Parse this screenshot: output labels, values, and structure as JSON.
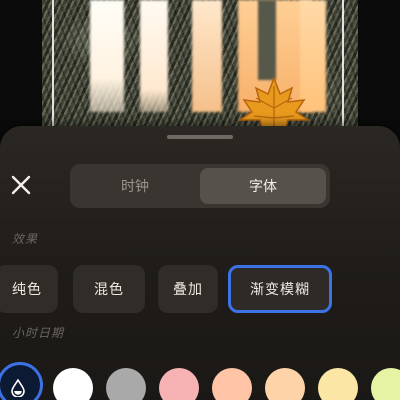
{
  "toolbar": {
    "close_icon": "close-icon"
  },
  "tabs": [
    {
      "label": "时钟",
      "selected": false
    },
    {
      "label": "字体",
      "selected": true
    }
  ],
  "sections": {
    "effect_label": "效果",
    "date_label": "小时日期"
  },
  "effects": [
    {
      "label": "纯色",
      "selected": false
    },
    {
      "label": "混色",
      "selected": false
    },
    {
      "label": "叠加",
      "selected": false
    },
    {
      "label": "渐变模糊",
      "selected": true
    }
  ],
  "colors": {
    "custom_icon": "color-drop-icon",
    "accent": "#3c72e6",
    "swatches": [
      "#ffffff",
      "#a9a9a9",
      "#f7b3b3",
      "#ffc3a6",
      "#ffd3a8",
      "#fbe6a6",
      "#e6f2a4"
    ]
  }
}
